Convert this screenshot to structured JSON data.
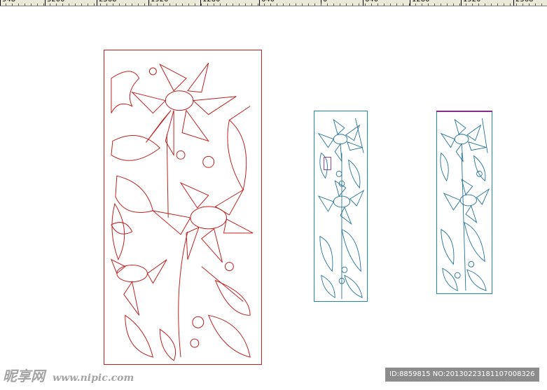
{
  "ruler": {
    "labels": [
      "948",
      "3200",
      "2568",
      "1920",
      "1280",
      "640",
      "0",
      "640",
      "1280",
      "1920",
      "2568"
    ]
  },
  "artwork": {
    "panel_large": {
      "name": "red sunflower carving panel",
      "stroke": "#c0201e"
    },
    "panel_medium": {
      "name": "blue sunflower carving panel",
      "stroke": "#1f8aa8"
    },
    "panel_small": {
      "name": "blue sunflower carving panel small",
      "stroke": "#1f8aa8",
      "top_edge": "#8a2a8a"
    }
  },
  "watermark": {
    "logo_text": "昵享网",
    "url": "www.nipic.com",
    "id_text": "ID:8859815 NO:20130223181107008326"
  },
  "colors": {
    "ruler_bg": "#ece9d8",
    "watermark_gray": "#a5a5a5",
    "badge_bg": "#8c8c8c"
  }
}
